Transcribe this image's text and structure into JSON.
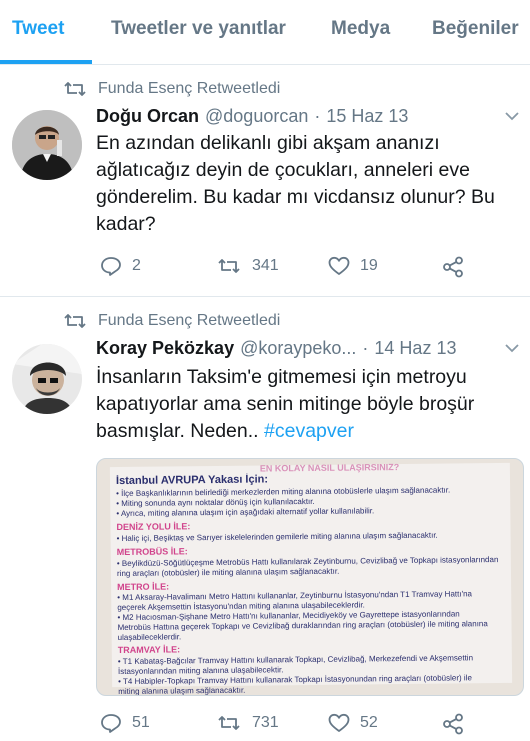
{
  "tabs": [
    {
      "label": "Tweet"
    },
    {
      "label": "Tweetler ve yanıtlar"
    },
    {
      "label": "Medya"
    },
    {
      "label": "Beğeniler"
    }
  ],
  "colors": {
    "accent": "#1da1f2",
    "muted": "#657786",
    "text": "#14171a",
    "divider": "#e1e8ed"
  },
  "tweets": [
    {
      "retweet_label": "Funda Esenç Retweetledi",
      "name": "Doğu Orcan",
      "handle": "@doguorcan",
      "separator": "·",
      "date": "15 Haz 13",
      "text_lines": [
        "En azından delikanlı gibi akşam ananızı",
        "ağlatıcağız deyin de çocukları, anneleri eve",
        "gönderelim. Bu kadar mı vicdansız olunur? Bu",
        "kadar?"
      ],
      "replies": "2",
      "retweets": "341",
      "likes": "19"
    },
    {
      "retweet_label": "Funda Esenç Retweetledi",
      "name": "Koray Peközkay",
      "handle": "@koraypeko...",
      "separator": "·",
      "date": "14 Haz 13",
      "text_lines": [
        "İnsanların Taksim'e gitmemesi için metroyu",
        "kapatıyorlar ama senin mitinge böyle broşür",
        "basmışlar. Neden.."
      ],
      "hashtag": "#cevapver",
      "replies": "51",
      "retweets": "731",
      "likes": "52",
      "brochure": {
        "top": "EN KOLAY NASIL ULAŞIRSINIZ?",
        "heading": "İstanbul AVRUPA Yakası İçin:",
        "lines": [
          "• İlçe Başkanlıklarının belirlediği merkezlerden miting alanına otobüslerle ulaşım sağlanacaktır.",
          "• Miting sonunda aynı noktalar dönüş için kullanılacaktır.",
          "• Ayrıca, miting alanına ulaşım için aşağıdaki alternatif yollar kullanılabilir.",
          "DENİZ YOLU İLE:",
          "• Haliç içi, Beşiktaş ve Sarıyer iskelelerinden gemilerle miting alanına ulaşım sağlanacaktır.",
          "METROBÜS İLE:",
          "• Beylikdüzü-Söğütlüçeşme Metrobüs Hattı kullanılarak Zeytinburnu, Cevizlibağ ve Topkapı istasyonlarından",
          "  ring araçları (otobüsler) ile miting alanına ulaşım sağlanacaktır.",
          "METRO İLE:",
          "• M1 Aksaray-Havalimanı Metro Hattını kullananlar, Zeytinburnu İstasyonu'ndan T1 Tramvay Hattı'na",
          "  geçerek Akşemsettin İstasyonu'ndan miting alanına ulaşabileceklerdir.",
          "• M2 Hacıosman-Şişhane Metro Hattı'nı kullananlar, Mecidiyeköy ve Gayrettepe istasyonlarından",
          "  Metrobüs Hattına geçerek Topkapı ve Cevizlibağ duraklarından ring araçları (otobüsler) ile miting alanına",
          "  ulaşabileceklerdir.",
          "TRAMVAY İLE:",
          "• T1 Kabataş-Bağcılar Tramvay Hattını kullanarak Topkapı, Cevizlibağ, Merkezefendi ve Akşemsettin",
          "  İstasyonlarından miting alanına ulaşabilecektir.",
          "• T4 Habipler-Topkapı Tramvay Hattını kullanarak Topkapı İstasyonundan ring araçları (otobüsler) ile",
          "  miting alanına ulaşım sağlanacaktır."
        ]
      }
    }
  ]
}
